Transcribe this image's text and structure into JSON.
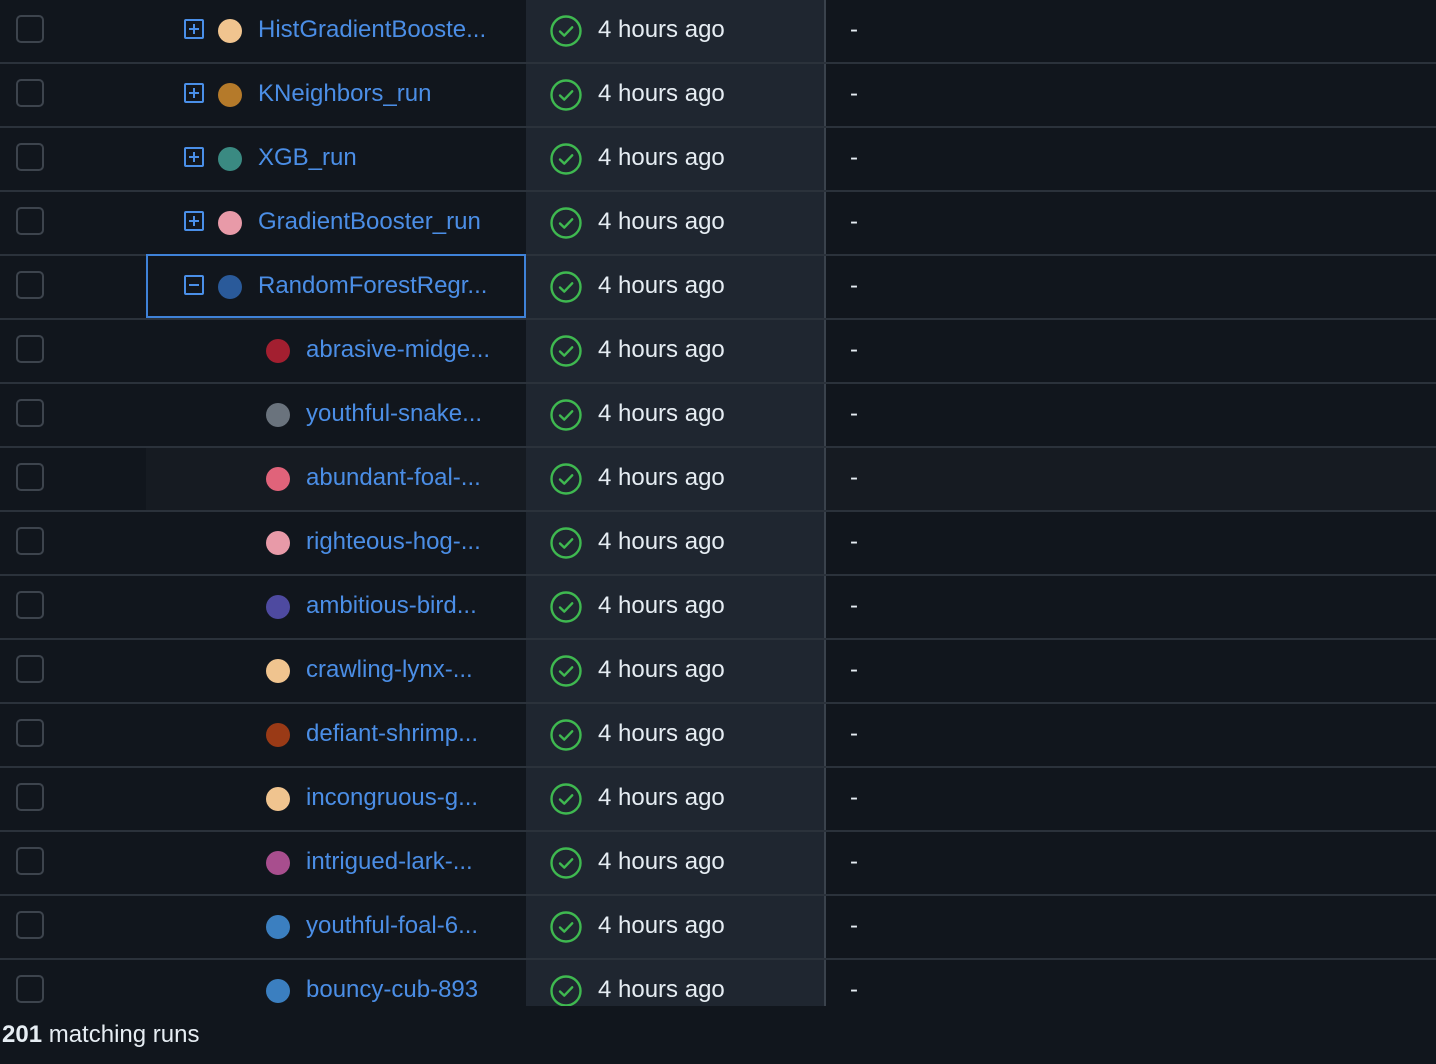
{
  "rows": [
    {
      "name": "HistGradientBooste...",
      "level": "parent",
      "expander": "plus",
      "color": "#f0c48f",
      "time": "4 hours ago",
      "extra": "-"
    },
    {
      "name": "KNeighbors_run",
      "level": "parent",
      "expander": "plus",
      "color": "#b57a2a",
      "time": "4 hours ago",
      "extra": "-"
    },
    {
      "name": "XGB_run",
      "level": "parent",
      "expander": "plus",
      "color": "#3a8a82",
      "time": "4 hours ago",
      "extra": "-"
    },
    {
      "name": "GradientBooster_run",
      "level": "parent",
      "expander": "plus",
      "color": "#e89aa8",
      "time": "4 hours ago",
      "extra": "-"
    },
    {
      "name": "RandomForestRegr...",
      "level": "parent",
      "expander": "minus",
      "color": "#2a5a9a",
      "time": "4 hours ago",
      "extra": "-",
      "selected": true
    },
    {
      "name": "abrasive-midge...",
      "level": "child",
      "color": "#a31f30",
      "time": "4 hours ago",
      "extra": "-"
    },
    {
      "name": "youthful-snake...",
      "level": "child",
      "color": "#6a737d",
      "time": "4 hours ago",
      "extra": "-"
    },
    {
      "name": "abundant-foal-...",
      "level": "child",
      "color": "#e0637a",
      "time": "4 hours ago",
      "extra": "-"
    },
    {
      "name": "righteous-hog-...",
      "level": "child",
      "color": "#e89aa8",
      "time": "4 hours ago",
      "extra": "-"
    },
    {
      "name": "ambitious-bird...",
      "level": "child",
      "color": "#4e4aa0",
      "time": "4 hours ago",
      "extra": "-"
    },
    {
      "name": "crawling-lynx-...",
      "level": "child",
      "color": "#f0c48f",
      "time": "4 hours ago",
      "extra": "-"
    },
    {
      "name": "defiant-shrimp...",
      "level": "child",
      "color": "#9a3a16",
      "time": "4 hours ago",
      "extra": "-"
    },
    {
      "name": "incongruous-g...",
      "level": "child",
      "color": "#f0c48f",
      "time": "4 hours ago",
      "extra": "-"
    },
    {
      "name": "intrigued-lark-...",
      "level": "child",
      "color": "#a84e8e",
      "time": "4 hours ago",
      "extra": "-"
    },
    {
      "name": "youthful-foal-6...",
      "level": "child",
      "color": "#3b7fc0",
      "time": "4 hours ago",
      "extra": "-"
    },
    {
      "name": "bouncy-cub-893",
      "level": "child",
      "color": "#3b7fc0",
      "time": "4 hours ago",
      "extra": "-"
    }
  ],
  "status_color": "#3fb950",
  "footer": {
    "count": "201",
    "label": "matching runs"
  }
}
